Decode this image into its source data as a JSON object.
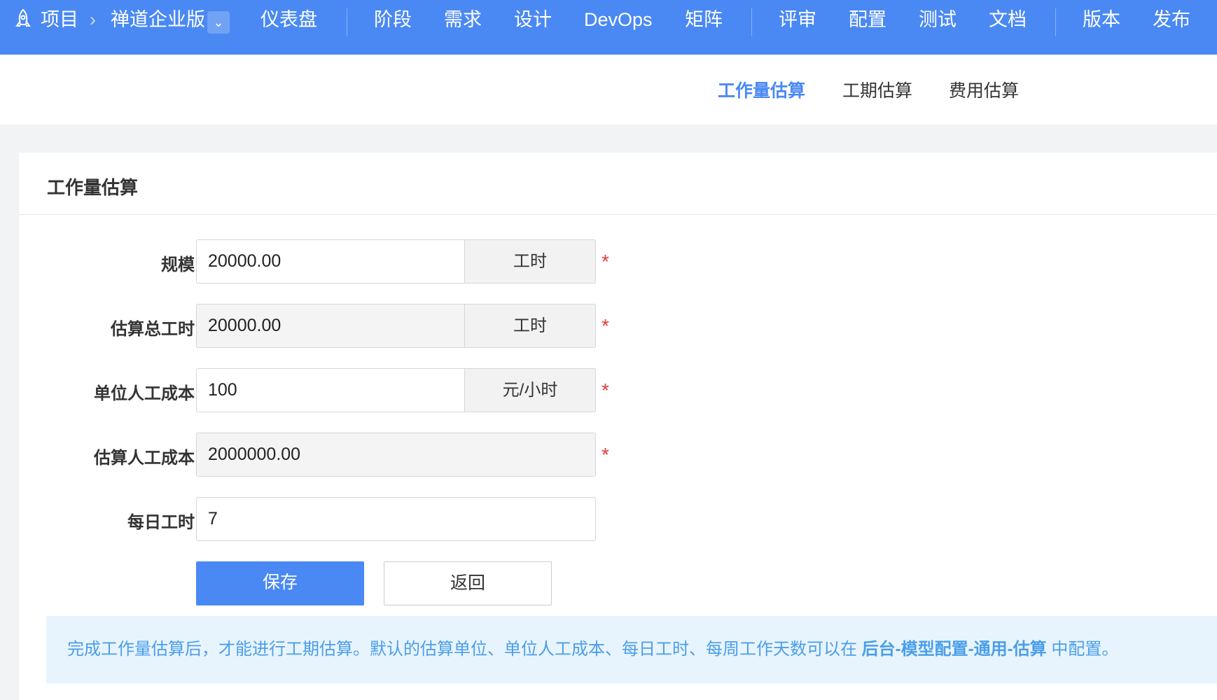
{
  "nav": {
    "project": "项目",
    "product": "禅道企业版",
    "items": [
      "仪表盘",
      "阶段",
      "需求",
      "设计",
      "DevOps",
      "矩阵",
      "评审",
      "配置",
      "测试",
      "文档",
      "版本",
      "发布"
    ]
  },
  "subnav": [
    "工作量估算",
    "工期估算",
    "费用估算"
  ],
  "card": {
    "title": "工作量估算",
    "rows": [
      {
        "label": "规模",
        "value": "20000.00",
        "unit": "工时"
      },
      {
        "label": "估算总工时",
        "value": "20000.00",
        "unit": "工时"
      },
      {
        "label": "单位人工成本",
        "value": "100",
        "unit": "元/小时"
      },
      {
        "label": "估算人工成本",
        "value": "2000000.00"
      },
      {
        "label": "每日工时",
        "value": "7"
      }
    ],
    "required": "*",
    "save": "保存",
    "back": "返回",
    "info": {
      "pre": "完成工作量估算后，才能进行工期估算。默认的估算单位、单位人工成本、每日工时、每周工作天数可以在 ",
      "link": "后台-模型配置-通用-估算",
      "post": " 中配置。"
    }
  },
  "colors": {
    "primary": "#4a89f3",
    "required": "#e53935",
    "info": "#4a9eea"
  }
}
